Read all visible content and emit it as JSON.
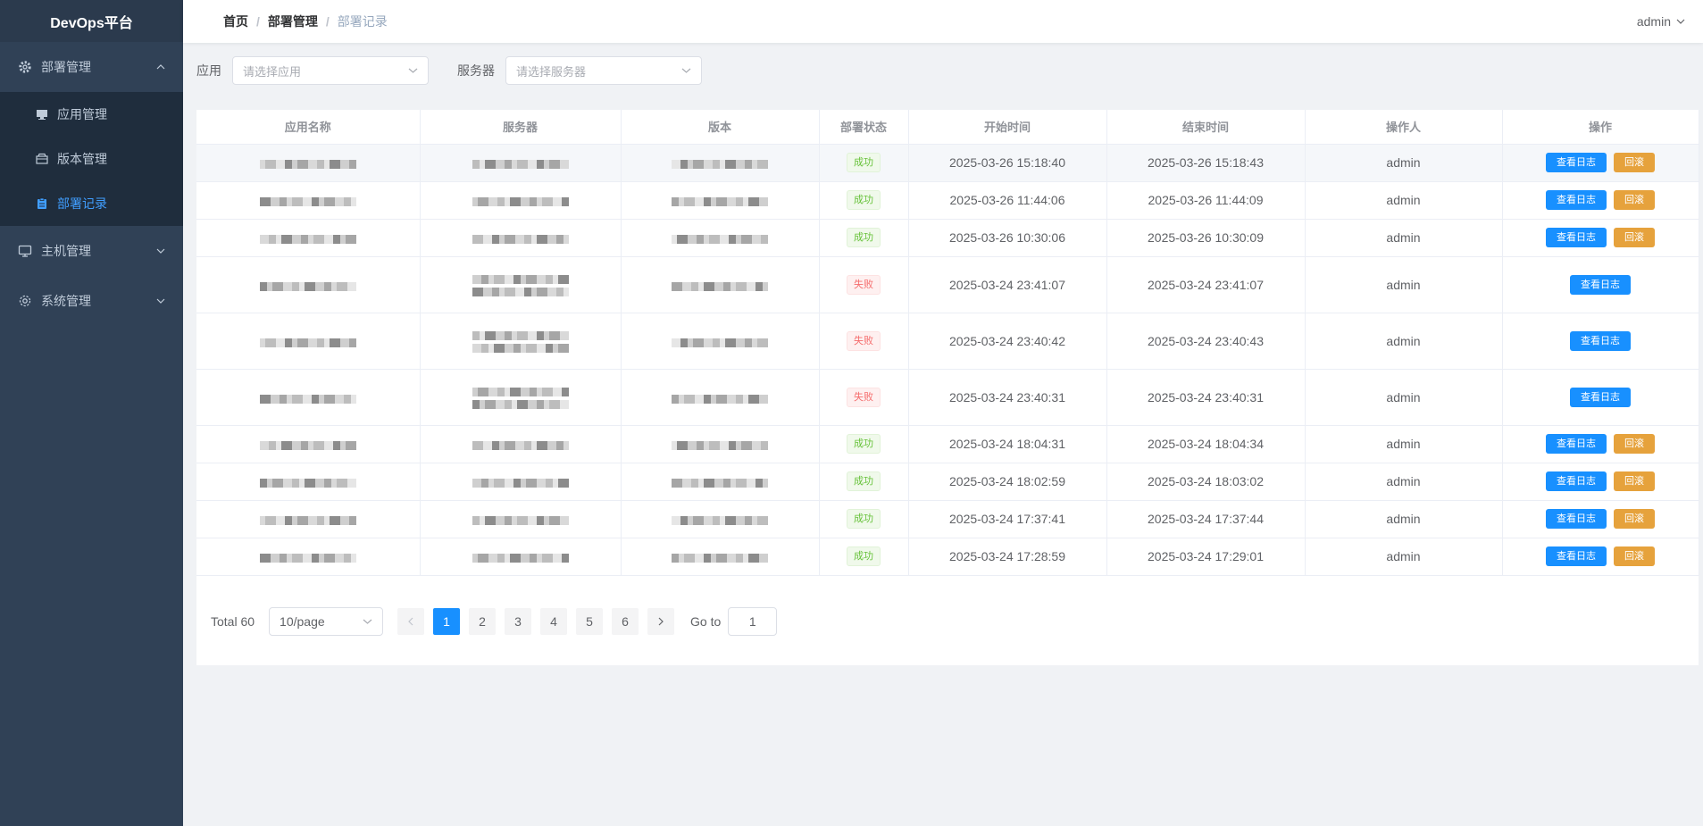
{
  "sidebar": {
    "logo": "DevOps平台",
    "groups": [
      {
        "label": "部署管理",
        "icon": "gear-icon",
        "expanded": true,
        "items": [
          {
            "label": "应用管理",
            "icon": "monitor-icon",
            "active": false
          },
          {
            "label": "版本管理",
            "icon": "box-icon",
            "active": false
          },
          {
            "label": "部署记录",
            "icon": "clipboard-icon",
            "active": true
          }
        ]
      },
      {
        "label": "主机管理",
        "icon": "monitor-icon",
        "expanded": false
      },
      {
        "label": "系统管理",
        "icon": "gear-icon",
        "expanded": false
      }
    ]
  },
  "header": {
    "breadcrumb": [
      "首页",
      "部署管理",
      "部署记录"
    ],
    "user": "admin"
  },
  "filters": {
    "app_label": "应用",
    "app_placeholder": "请选择应用",
    "server_label": "服务器",
    "server_placeholder": "请选择服务器"
  },
  "table": {
    "columns": [
      "应用名称",
      "服务器",
      "版本",
      "部署状态",
      "开始时间",
      "结束时间",
      "操作人",
      "操作"
    ],
    "view_log_label": "查看日志",
    "rollback_label": "回滚",
    "rows": [
      {
        "status": "成功",
        "ok": true,
        "start": "2025-03-26 15:18:40",
        "end": "2025-03-26 15:18:43",
        "operator": "admin"
      },
      {
        "status": "成功",
        "ok": true,
        "start": "2025-03-26 11:44:06",
        "end": "2025-03-26 11:44:09",
        "operator": "admin"
      },
      {
        "status": "成功",
        "ok": true,
        "start": "2025-03-26 10:30:06",
        "end": "2025-03-26 10:30:09",
        "operator": "admin"
      },
      {
        "status": "失败",
        "ok": false,
        "start": "2025-03-24 23:41:07",
        "end": "2025-03-24 23:41:07",
        "operator": "admin"
      },
      {
        "status": "失败",
        "ok": false,
        "start": "2025-03-24 23:40:42",
        "end": "2025-03-24 23:40:43",
        "operator": "admin"
      },
      {
        "status": "失败",
        "ok": false,
        "start": "2025-03-24 23:40:31",
        "end": "2025-03-24 23:40:31",
        "operator": "admin"
      },
      {
        "status": "成功",
        "ok": true,
        "start": "2025-03-24 18:04:31",
        "end": "2025-03-24 18:04:34",
        "operator": "admin"
      },
      {
        "status": "成功",
        "ok": true,
        "start": "2025-03-24 18:02:59",
        "end": "2025-03-24 18:03:02",
        "operator": "admin"
      },
      {
        "status": "成功",
        "ok": true,
        "start": "2025-03-24 17:37:41",
        "end": "2025-03-24 17:37:44",
        "operator": "admin"
      },
      {
        "status": "成功",
        "ok": true,
        "start": "2025-03-24 17:28:59",
        "end": "2025-03-24 17:29:01",
        "operator": "admin"
      }
    ]
  },
  "pagination": {
    "total_label": "Total 60",
    "page_size": "10/page",
    "pages": [
      "1",
      "2",
      "3",
      "4",
      "5",
      "6"
    ],
    "current": "1",
    "goto_label": "Go to",
    "goto_value": "1"
  },
  "colors": {
    "sidebar_bg": "#304156",
    "accent": "#1890ff",
    "warning": "#e6a23c",
    "success": "#67c23a",
    "danger": "#f56c6c"
  }
}
